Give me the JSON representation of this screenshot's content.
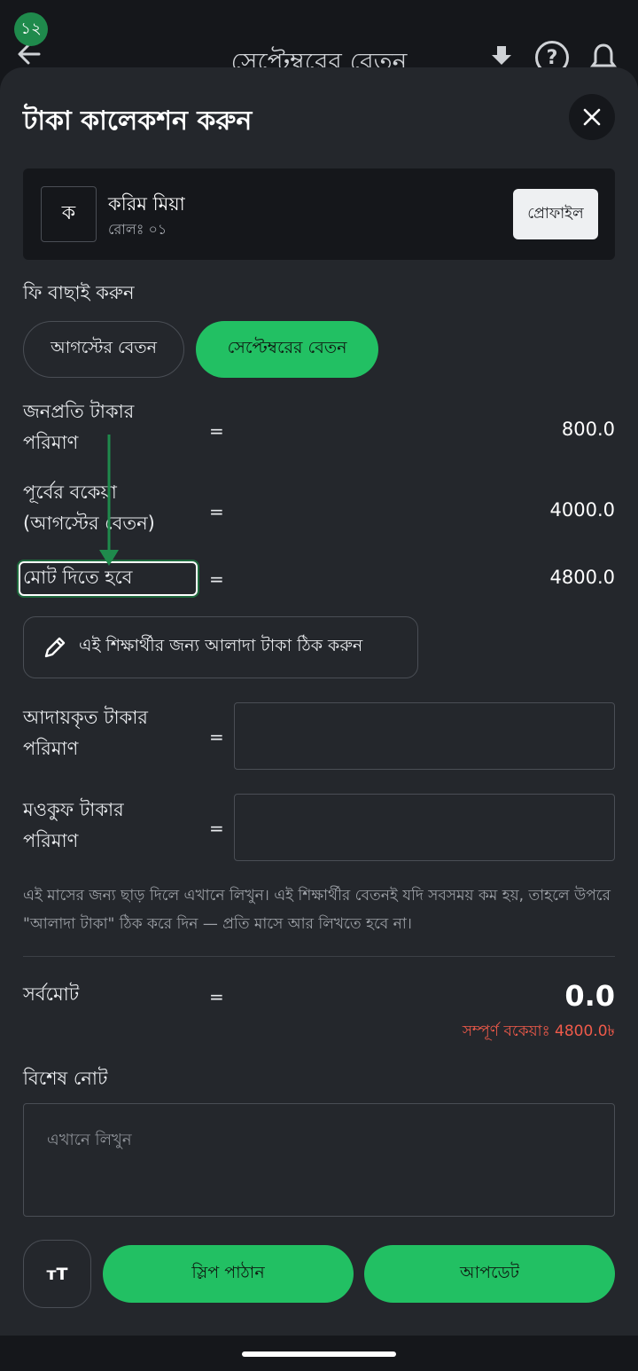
{
  "appbar": {
    "step_badge": "১২",
    "title": "সেপ্টেম্বরের বেতন",
    "help_symbol": "?"
  },
  "sheet": {
    "title": "টাকা কালেকশন করুন",
    "close_icon": "close-icon"
  },
  "student": {
    "avatar_letter": "ক",
    "name": "করিম মিয়া",
    "roll": "রোলঃ ০১",
    "profile_label": "প্রোফাইল"
  },
  "fee_select": {
    "label": "ফি বাছাই করুন",
    "options": [
      "আগস্টের বেতন",
      "সেপ্টেম্বরের বেতন"
    ],
    "selected": "সেপ্টেম্বরের বেতন"
  },
  "rows": {
    "per_person": {
      "label_line1": "জনপ্রতি টাকার",
      "label_line2": "পরিমাণ",
      "eq": "=",
      "value": "800.0"
    },
    "previous_due": {
      "label_line1": "পূর্বের বকেয়া",
      "label_line2": "(আগস্টের বেতন)",
      "eq": "=",
      "value": "4000.0"
    },
    "total_payable": {
      "label": "মোট দিতে হবে",
      "eq": "=",
      "value": "4800.0"
    }
  },
  "override_button": {
    "label": "এই শিক্ষার্থীর জন্য আলাদা টাকা ঠিক করুন",
    "icon": "pencil-icon"
  },
  "inputs": {
    "collected": {
      "label_line1": "আদায়কৃত টাকার",
      "label_line2": "পরিমাণ",
      "eq": "=",
      "value": ""
    },
    "waived": {
      "label_line1": "মওকুফ টাকার",
      "label_line2": "পরিমাণ",
      "eq": "=",
      "value": ""
    }
  },
  "hint": "এই মাসের জন্য ছাড় দিলে এখানে লিখুন। এই শিক্ষার্থীর বেতনই যদি সবসময় কম হয়, তাহলে উপরে \"আলাদা টাকা\" ঠিক করে দিন — প্রতি মাসে আর লিখতে হবে না।",
  "grand_total": {
    "label": "সর্বমোট",
    "eq": "=",
    "value": "0.0",
    "due_text": "সম্পূর্ণ বকেয়াঃ 4800.0৳"
  },
  "note": {
    "label": "বিশেষ নোট",
    "placeholder": "এখানে লিখুন"
  },
  "actions": {
    "font_size_label": "ᴛT",
    "slip_label": "স্লিপ পাঠান",
    "update_label": "আপডেট"
  },
  "colors": {
    "accent": "#22c063",
    "sheet_bg": "#24272c",
    "card_bg": "#15171b",
    "due_red": "#ef5a4a",
    "annotation_green": "#1f8a4c"
  }
}
